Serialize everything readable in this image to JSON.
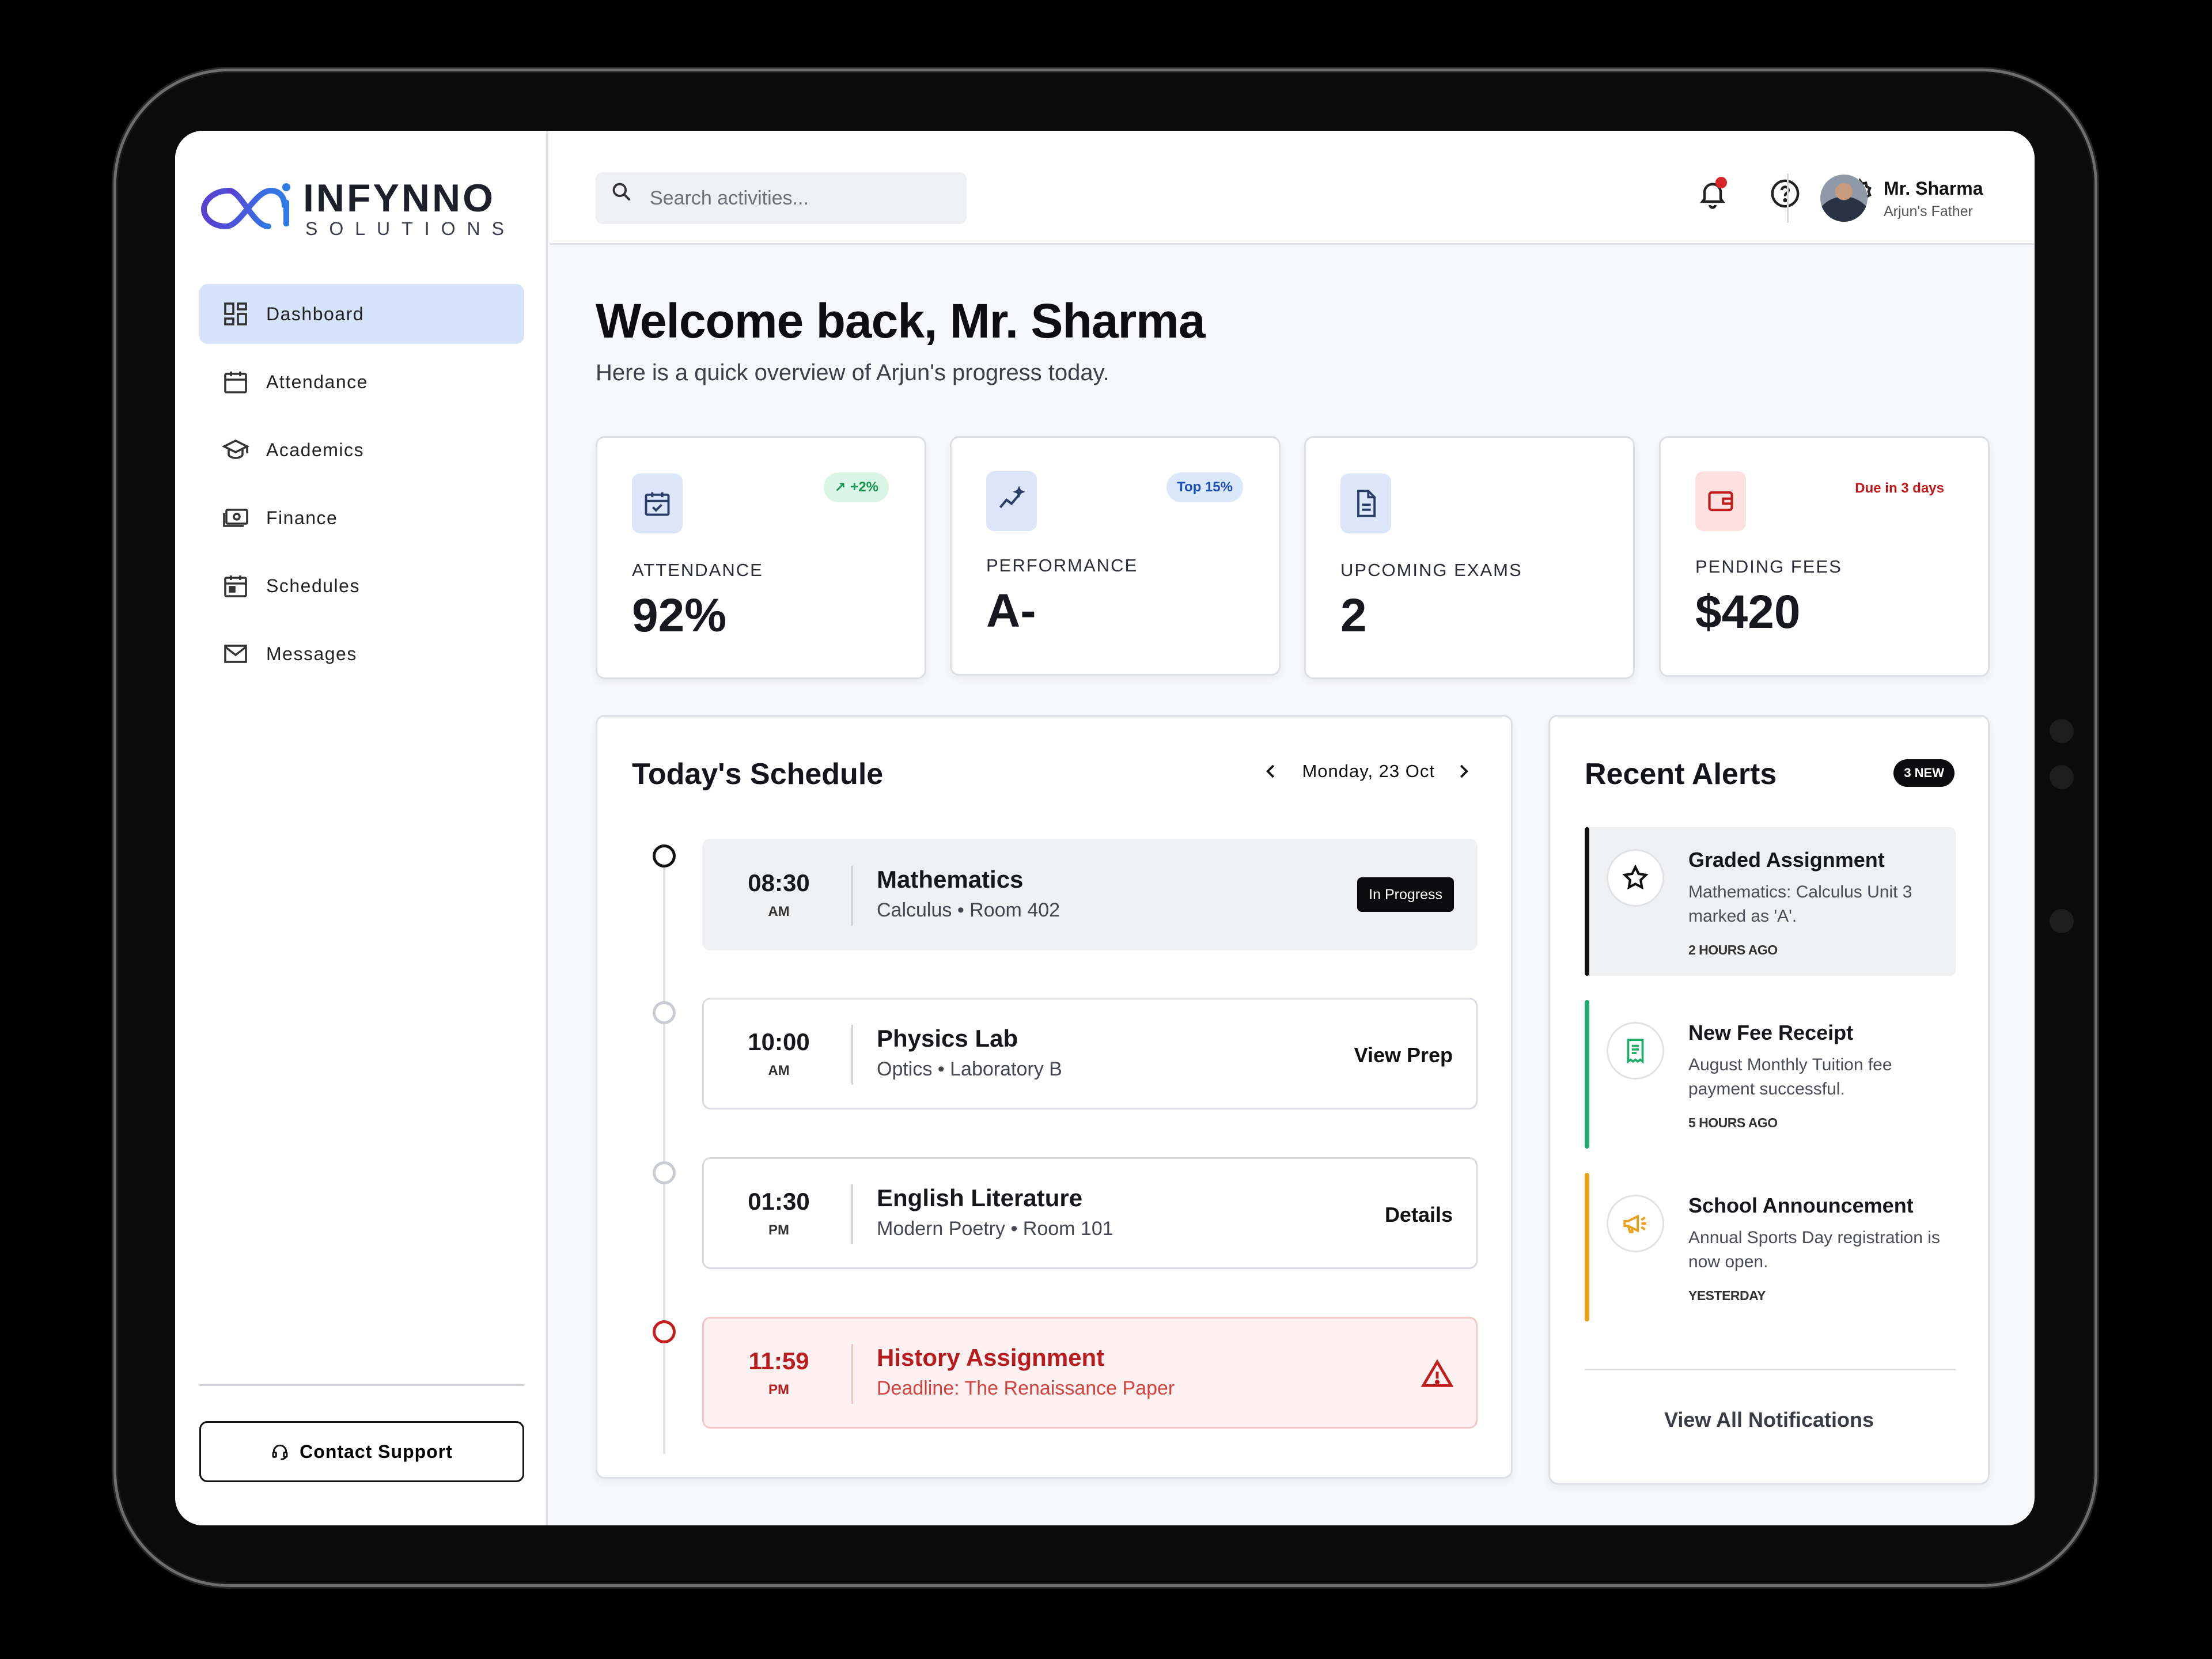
{
  "brand": {
    "name": "INFYNNO",
    "tagline": "SOLUTIONS",
    "accent_gradient": [
      "#5b3fd1",
      "#2f7be6"
    ]
  },
  "sidebar": {
    "items": [
      {
        "label": "Dashboard",
        "icon": "dashboard-grid-icon",
        "active": true
      },
      {
        "label": "Attendance",
        "icon": "calendar-icon"
      },
      {
        "label": "Academics",
        "icon": "graduation-cap-icon"
      },
      {
        "label": "Finance",
        "icon": "cash-icon"
      },
      {
        "label": "Schedules",
        "icon": "calendar-day-icon"
      },
      {
        "label": "Messages",
        "icon": "mail-icon"
      }
    ],
    "support_label": "Contact Support"
  },
  "topbar": {
    "search_placeholder": "Search activities...",
    "user_name": "Mr. Sharma",
    "user_role": "Arjun's Father"
  },
  "welcome": {
    "title": "Welcome back, Mr. Sharma",
    "subtitle": "Here is a quick overview of Arjun's progress today."
  },
  "stats": [
    {
      "label": "ATTENDANCE",
      "value": "92%",
      "badge": "+2%",
      "color": "#dbe6fb"
    },
    {
      "label": "PERFORMANCE",
      "value": "A-",
      "badge": "Top 15%",
      "color": "#dbe6fb"
    },
    {
      "label": "UPCOMING EXAMS",
      "value": "2",
      "badge": "",
      "color": "#dbe6fb"
    },
    {
      "label": "PENDING FEES",
      "value": "$420",
      "badge": "Due in 3 days",
      "color": "#fde0e0"
    }
  ],
  "schedule": {
    "title": "Today's Schedule",
    "date": "Monday, 23 Oct",
    "items": [
      {
        "time": "08:30",
        "ampm": "AM",
        "subject": "Mathematics",
        "detail": "Calculus • Room 402",
        "status": "In Progress"
      },
      {
        "time": "10:00",
        "ampm": "AM",
        "subject": "Physics Lab",
        "detail": "Optics • Laboratory B",
        "action": "View Prep"
      },
      {
        "time": "01:30",
        "ampm": "PM",
        "subject": "English Literature",
        "detail": "Modern Poetry • Room 101",
        "action": "Details"
      },
      {
        "time": "11:59",
        "ampm": "PM",
        "subject": "History Assignment",
        "detail": "Deadline: The Renaissance Paper",
        "status": "warning"
      }
    ]
  },
  "alerts": {
    "title": "Recent Alerts",
    "new_badge": "3 NEW",
    "items": [
      {
        "title": "Graded Assignment",
        "body": "Mathematics: Calculus Unit 3 marked as 'A'.",
        "time": "2 HOURS AGO",
        "icon": "star-icon",
        "color": "#111111"
      },
      {
        "title": "New Fee Receipt",
        "body": "August Monthly Tuition fee payment successful.",
        "time": "5 HOURS AGO",
        "icon": "receipt-icon",
        "color": "#1fae6a"
      },
      {
        "title": "School Announcement",
        "body": "Annual Sports Day registration is now open.",
        "time": "YESTERDAY",
        "icon": "megaphone-icon",
        "color": "#e9a11a"
      }
    ],
    "view_all": "View All Notifications"
  }
}
